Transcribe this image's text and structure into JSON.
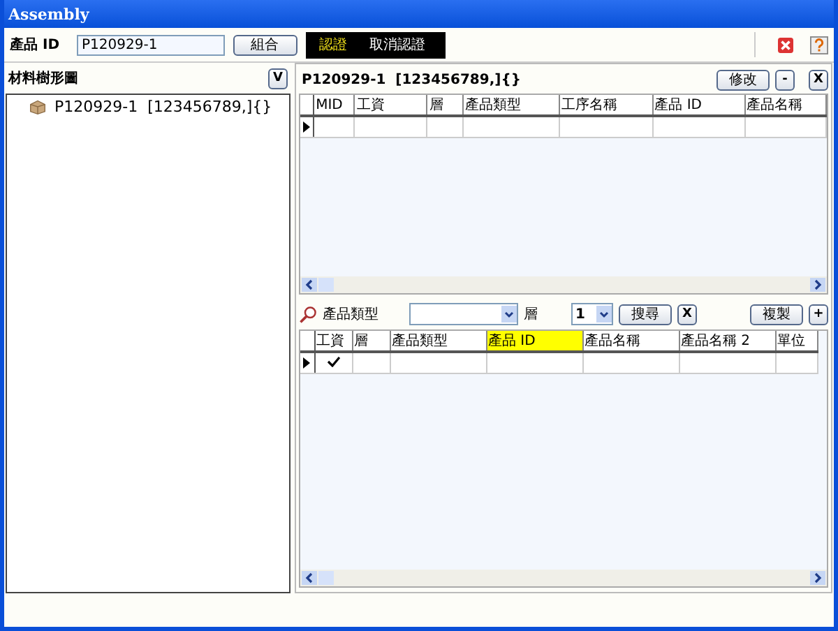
{
  "window": {
    "title": "Assembly"
  },
  "toolbar": {
    "product_id_label": "產品 ID",
    "product_id_value": "P120929-1",
    "combine_button": "組合",
    "certify_button": "認證",
    "uncertify_button": "取消認證"
  },
  "tree_panel": {
    "title": "材料樹形圖",
    "toggle": "V",
    "items": [
      {
        "label": "P120929-1  [123456789,]{}"
      }
    ]
  },
  "top_grid": {
    "title": "P120929-1  [123456789,]{}",
    "buttons": [
      "修改",
      "-"
    ],
    "close": "X",
    "columns": [
      {
        "label": "MID"
      },
      {
        "label": "工資"
      },
      {
        "label": "層"
      },
      {
        "label": "產品類型"
      },
      {
        "label": "工序名稱"
      },
      {
        "label": "產品 ID"
      },
      {
        "label": "產品名稱"
      }
    ],
    "rows": [
      {
        "current": true
      }
    ]
  },
  "bottom_grid": {
    "filter_label": "產品類型",
    "level_label": "層",
    "level_value": "1",
    "search_button": "搜尋",
    "clear_button": "X",
    "copy_button": "複製",
    "add_button": "+",
    "columns": [
      {
        "label": "工資",
        "highlighted": false
      },
      {
        "label": "層",
        "highlighted": false
      },
      {
        "label": "產品類型",
        "highlighted": false
      },
      {
        "label": "產品 ID",
        "highlighted": true
      },
      {
        "label": "產品名稱",
        "highlighted": false
      },
      {
        "label": "產品名稱 2",
        "highlighted": false
      },
      {
        "label": "單位",
        "highlighted": false
      }
    ],
    "rows": [
      {
        "current": true,
        "wage_checked": true
      }
    ]
  }
}
